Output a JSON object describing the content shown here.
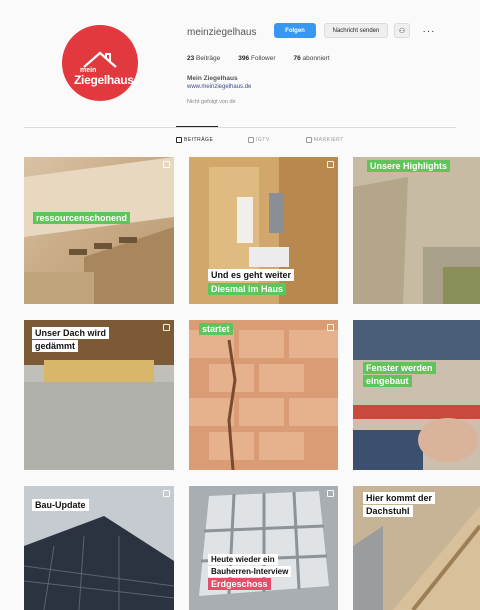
{
  "profile": {
    "username": "meinziegelhaus",
    "logo_small": "mein",
    "logo_big": "Ziegelhaus",
    "follow_label": "Folgen",
    "message_label": "Nachricht senden",
    "suggest_icon": "person-plus-icon",
    "more_icon": "more-dots-icon",
    "more_label": "···",
    "suggest_label": "⚇",
    "stats": [
      {
        "count": "23",
        "label": "Beiträge"
      },
      {
        "count": "396",
        "label": "Follower"
      },
      {
        "count": "76",
        "label": "abonniert"
      }
    ],
    "bio_name": "Mein Ziegelhaus",
    "bio_link": "www.meinziegelhaus.de",
    "bio_followed_by": "Nicht gefolgt von dir"
  },
  "tabs": [
    {
      "label": "BEITRÄGE",
      "icon": "grid-icon",
      "active": true
    },
    {
      "label": "IGTV",
      "icon": "tv-icon",
      "active": false
    },
    {
      "label": "MARKIERT",
      "icon": "tag-icon",
      "active": false
    }
  ],
  "posts": [
    {
      "captions": [
        "ressourcenschonend"
      ],
      "style": [
        "green"
      ]
    },
    {
      "captions": [
        "Und es geht weiter",
        "Diesmal im Haus"
      ],
      "style": [
        "white",
        "green"
      ]
    },
    {
      "captions": [
        "Unsere Highlights"
      ],
      "style": [
        "green"
      ]
    },
    {
      "captions": [
        "Unser Dach wird",
        "gedämmt"
      ],
      "style": [
        "white",
        "white"
      ]
    },
    {
      "captions": [
        "startet"
      ],
      "style": [
        "green"
      ]
    },
    {
      "captions": [
        "Fenster werden",
        "eingebaut"
      ],
      "style": [
        "green",
        "green"
      ]
    },
    {
      "captions": [
        "Bau-Update"
      ],
      "style": [
        "white"
      ]
    },
    {
      "captions": [
        "Heute wieder ein",
        "Bauherren-Interview",
        "Erdgeschoss"
      ],
      "style": [
        "white",
        "white",
        "red"
      ]
    },
    {
      "captions": [
        "Hier kommt der",
        "Dachstuhl"
      ],
      "style": [
        "white",
        "white"
      ]
    }
  ],
  "colors": {
    "accent_blue": "#3897f0",
    "brand_red": "#e2393f",
    "caption_green": "#5fc459",
    "caption_red": "#ea4b6a"
  }
}
